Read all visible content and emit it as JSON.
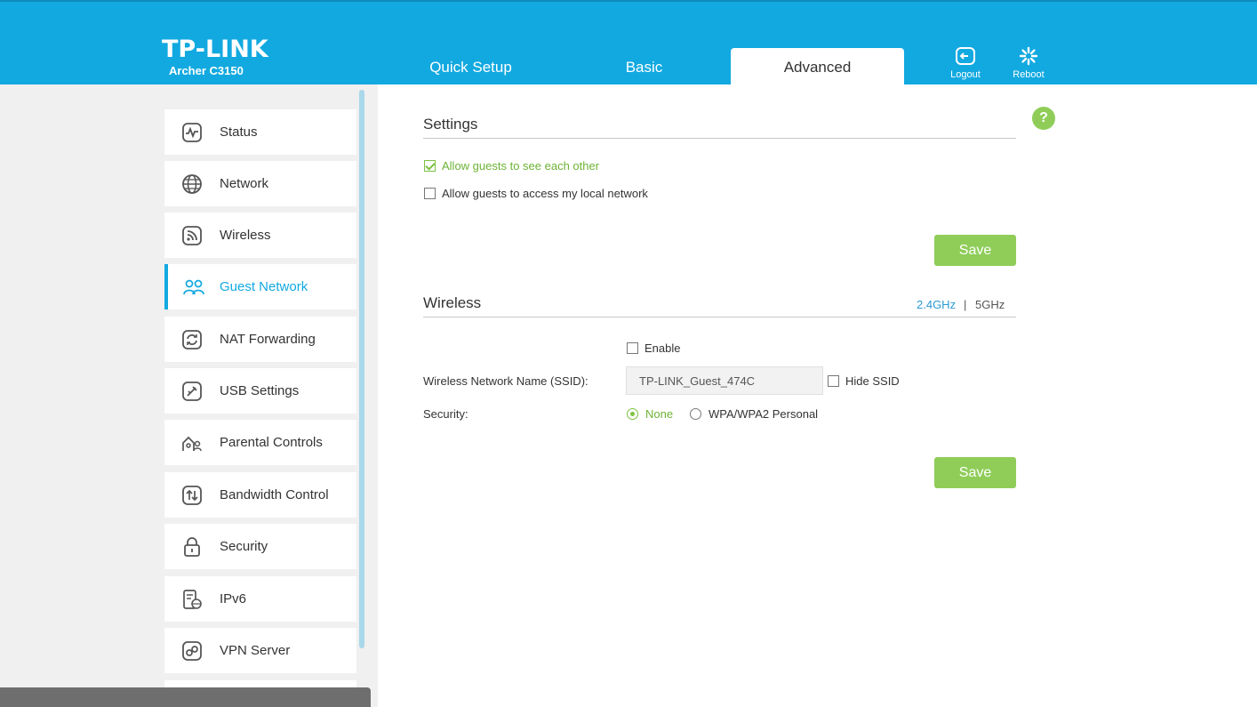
{
  "header": {
    "brand": "TP-LINK",
    "model": "Archer C3150",
    "tabs": [
      {
        "label": "Quick Setup",
        "active": false
      },
      {
        "label": "Basic",
        "active": false
      },
      {
        "label": "Advanced",
        "active": true
      }
    ],
    "logout_label": "Logout",
    "reboot_label": "Reboot"
  },
  "sidebar": {
    "items": [
      {
        "label": "Status",
        "icon": "status-icon"
      },
      {
        "label": "Network",
        "icon": "globe-icon"
      },
      {
        "label": "Wireless",
        "icon": "wireless-icon"
      },
      {
        "label": "Guest Network",
        "icon": "guest-network-icon",
        "active": true
      },
      {
        "label": "NAT Forwarding",
        "icon": "nat-forwarding-icon"
      },
      {
        "label": "USB Settings",
        "icon": "usb-icon"
      },
      {
        "label": "Parental Controls",
        "icon": "parental-controls-icon"
      },
      {
        "label": "Bandwidth Control",
        "icon": "bandwidth-icon"
      },
      {
        "label": "Security",
        "icon": "lock-icon"
      },
      {
        "label": "IPv6",
        "icon": "ipv6-icon"
      },
      {
        "label": "VPN Server",
        "icon": "vpn-icon"
      }
    ]
  },
  "settings": {
    "title": "Settings",
    "allow_see_each_other": {
      "label": "Allow guests to see each other",
      "checked": true
    },
    "allow_local_network": {
      "label": "Allow guests to access my local network",
      "checked": false
    },
    "save_label": "Save"
  },
  "wireless": {
    "title": "Wireless",
    "band_24": "2.4GHz",
    "band_sep": "|",
    "band_5": "5GHz",
    "selected_band": "2.4GHz",
    "enable": {
      "label": "Enable",
      "checked": false
    },
    "ssid_label": "Wireless Network Name (SSID):",
    "ssid_value": "TP-LINK_Guest_474C",
    "hide_ssid": {
      "label": "Hide SSID",
      "checked": false
    },
    "security_label": "Security:",
    "security_options": [
      {
        "label": "None",
        "selected": true
      },
      {
        "label": "WPA/WPA2 Personal",
        "selected": false
      }
    ],
    "save_label": "Save"
  },
  "help_label": "?",
  "colors": {
    "header": "#12a9e0",
    "accent_green": "#8fcd58",
    "active_blue": "#12a9e0"
  }
}
